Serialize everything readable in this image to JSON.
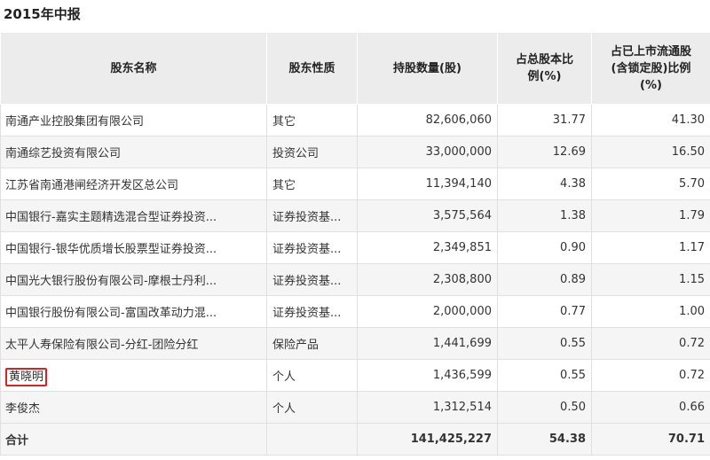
{
  "title": "2015年中报",
  "headers": {
    "name": "股东名称",
    "nature": "股东性质",
    "shares": "持股数量(股)",
    "ratio_total": "占总股本比例(%)",
    "ratio_float": "占已上市流通股(含锁定股)比例(%)"
  },
  "rows": [
    {
      "name": "南通产业控股集团有限公司",
      "nature": "其它",
      "shares": "82,606,060",
      "ratio_total": "31.77",
      "ratio_float": "41.30"
    },
    {
      "name": "南通综艺投资有限公司",
      "nature": "投资公司",
      "shares": "33,000,000",
      "ratio_total": "12.69",
      "ratio_float": "16.50"
    },
    {
      "name": "江苏省南通港闸经济开发区总公司",
      "nature": "其它",
      "shares": "11,394,140",
      "ratio_total": "4.38",
      "ratio_float": "5.70"
    },
    {
      "name": "中国银行-嘉实主题精选混合型证券投资...",
      "nature": "证券投资基...",
      "shares": "3,575,564",
      "ratio_total": "1.38",
      "ratio_float": "1.79"
    },
    {
      "name": "中国银行-银华优质增长股票型证券投资...",
      "nature": "证券投资基...",
      "shares": "2,349,851",
      "ratio_total": "0.90",
      "ratio_float": "1.17"
    },
    {
      "name": "中国光大银行股份有限公司-摩根士丹利...",
      "nature": "证券投资基...",
      "shares": "2,308,800",
      "ratio_total": "0.89",
      "ratio_float": "1.15"
    },
    {
      "name": "中国银行股份有限公司-富国改革动力混...",
      "nature": "证券投资基...",
      "shares": "2,000,000",
      "ratio_total": "0.77",
      "ratio_float": "1.00"
    },
    {
      "name": "太平人寿保险有限公司-分红-团险分红",
      "nature": "保险产品",
      "shares": "1,441,699",
      "ratio_total": "0.55",
      "ratio_float": "0.72"
    },
    {
      "name": "黄晓明",
      "nature": "个人",
      "shares": "1,436,599",
      "ratio_total": "0.55",
      "ratio_float": "0.72"
    },
    {
      "name": "李俊杰",
      "nature": "个人",
      "shares": "1,312,514",
      "ratio_total": "0.50",
      "ratio_float": "0.66"
    }
  ],
  "total": {
    "label": "合计",
    "shares": "141,425,227",
    "ratio_total": "54.38",
    "ratio_float": "70.71"
  },
  "colors": {
    "header_bg": "#ececec",
    "row_alt": "#f5f5f5",
    "highlight": "#e02020"
  }
}
